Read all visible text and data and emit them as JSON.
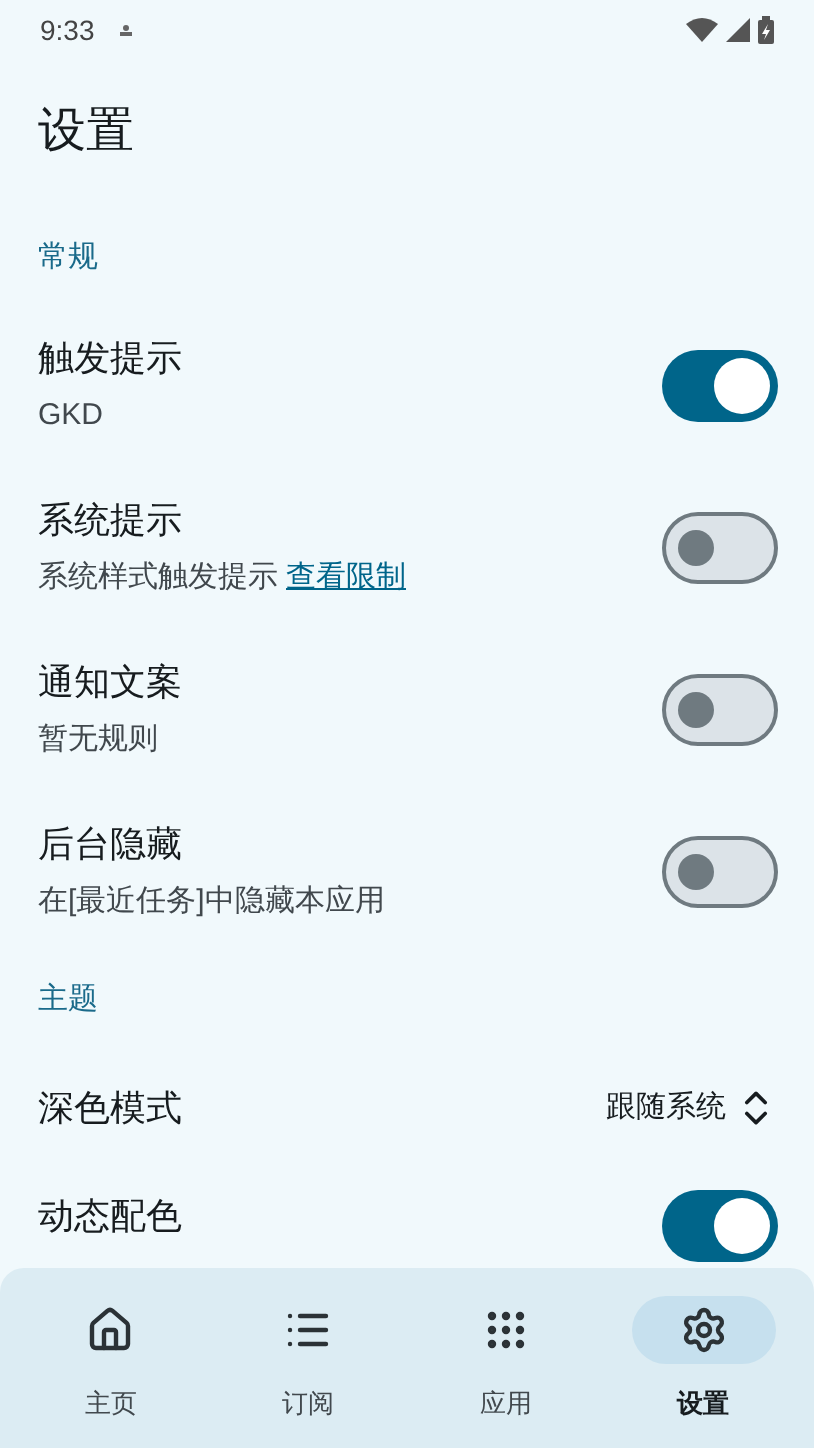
{
  "status_bar": {
    "time": "9:33"
  },
  "title": "设置",
  "sections": [
    {
      "header": "常规",
      "items": [
        {
          "kind": "toggle",
          "title": "触发提示",
          "subtitle": "GKD",
          "on": true
        },
        {
          "kind": "toggle",
          "title": "系统提示",
          "subtitle": "系统样式触发提示",
          "link": "查看限制",
          "on": false
        },
        {
          "kind": "toggle",
          "title": "通知文案",
          "subtitle": "暂无规则",
          "on": false
        },
        {
          "kind": "toggle",
          "title": "后台隐藏",
          "subtitle": "在[最近任务]中隐藏本应用",
          "on": false
        }
      ]
    },
    {
      "header": "主题",
      "items": [
        {
          "kind": "select",
          "title": "深色模式",
          "value": "跟随系统"
        },
        {
          "kind": "toggle",
          "title": "动态配色",
          "on": true
        }
      ]
    }
  ],
  "nav": [
    {
      "label": "主页",
      "selected": false
    },
    {
      "label": "订阅",
      "selected": false
    },
    {
      "label": "应用",
      "selected": false
    },
    {
      "label": "设置",
      "selected": true
    }
  ]
}
